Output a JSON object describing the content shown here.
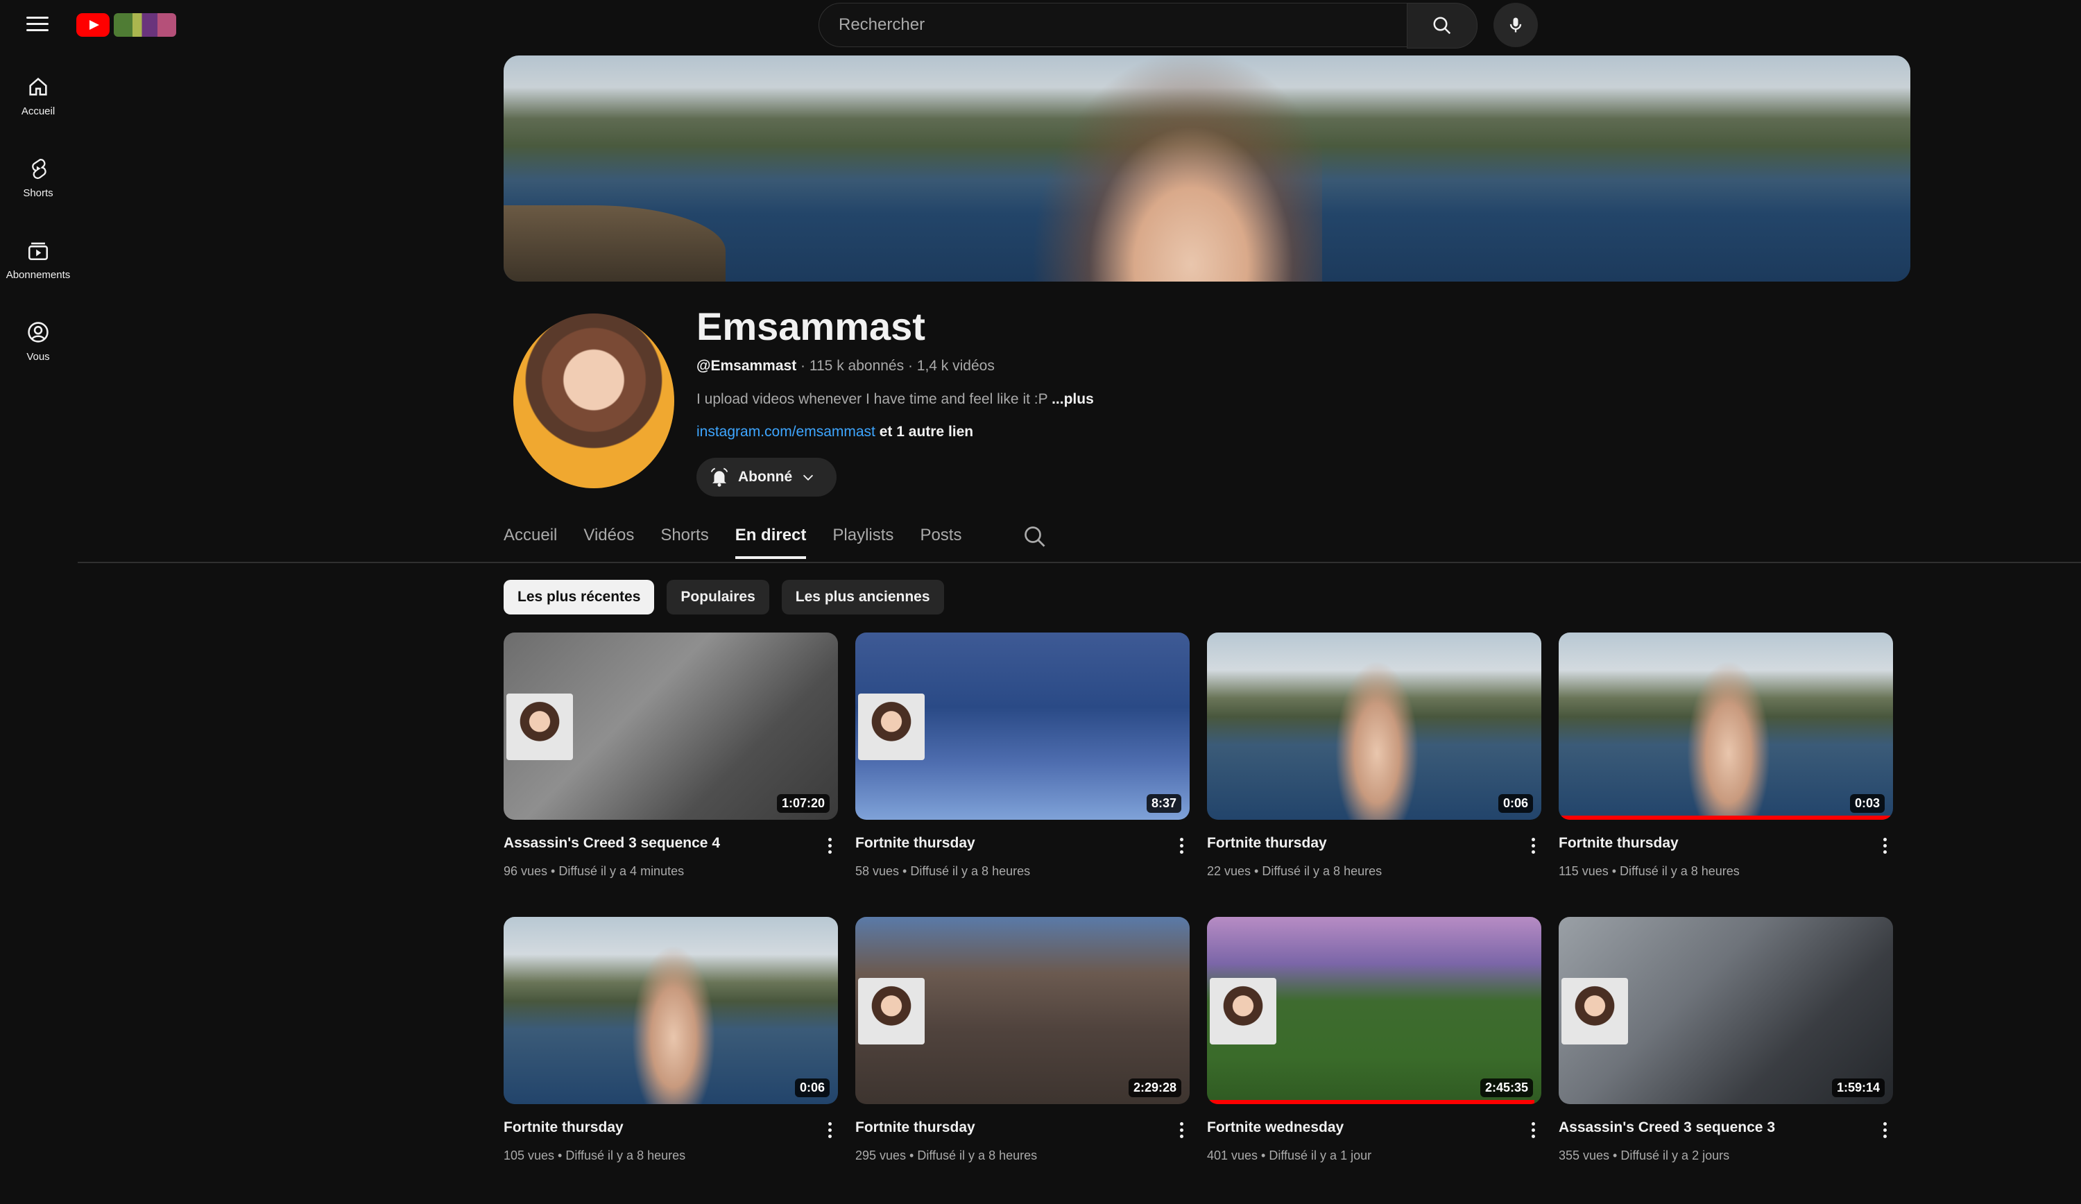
{
  "search": {
    "placeholder": "Rechercher"
  },
  "sidebar": {
    "items": [
      {
        "label": "Accueil",
        "icon": "home-icon"
      },
      {
        "label": "Shorts",
        "icon": "shorts-icon"
      },
      {
        "label": "Abonnements",
        "icon": "subscriptions-icon"
      },
      {
        "label": "Vous",
        "icon": "account-icon"
      }
    ]
  },
  "channel": {
    "name": "Emsammast",
    "handle": "@Emsammast",
    "meta": " · 115 k abonnés · 1,4 k vidéos",
    "description": "I upload videos whenever I have time and feel like it :P ",
    "description_more": "...plus",
    "link": "instagram.com/emsammast",
    "link_suffix": " et 1 autre lien",
    "subscribe_label": "Abonné"
  },
  "tabs": [
    {
      "label": "Accueil",
      "active": false
    },
    {
      "label": "Vidéos",
      "active": false
    },
    {
      "label": "Shorts",
      "active": false
    },
    {
      "label": "En direct",
      "active": true
    },
    {
      "label": "Playlists",
      "active": false
    },
    {
      "label": "Posts",
      "active": false
    }
  ],
  "chips": [
    {
      "label": "Les plus récentes",
      "active": true
    },
    {
      "label": "Populaires",
      "active": false
    },
    {
      "label": "Les plus anciennes",
      "active": false
    }
  ],
  "videos": [
    {
      "title": "Assassin's Creed 3 sequence 4",
      "meta": "96 vues • Diffusé il y a 4 minutes",
      "duration": "1:07:20"
    },
    {
      "title": "Fortnite thursday",
      "meta": "58 vues • Diffusé il y a 8 heures",
      "duration": "8:37"
    },
    {
      "title": "Fortnite thursday",
      "meta": "22 vues • Diffusé il y a 8 heures",
      "duration": "0:06"
    },
    {
      "title": "Fortnite thursday",
      "meta": "115 vues • Diffusé il y a 8 heures",
      "duration": "0:03",
      "watched_fraction": 1.0
    },
    {
      "title": "Fortnite thursday",
      "meta": "105 vues • Diffusé il y a 8 heures",
      "duration": "0:06"
    },
    {
      "title": "Fortnite thursday",
      "meta": "295 vues • Diffusé il y a 8 heures",
      "duration": "2:29:28"
    },
    {
      "title": "Fortnite wednesday",
      "meta": "401 vues • Diffusé il y a 1 jour",
      "duration": "2:45:35",
      "watched_fraction": 0.98
    },
    {
      "title": "Assassin's Creed 3 sequence 3",
      "meta": "355 vues • Diffusé il y a 2 jours",
      "duration": "1:59:14"
    }
  ],
  "colors": {
    "background": "#0f0f0f",
    "accent": "#ff0000",
    "link": "#3ea6ff"
  }
}
